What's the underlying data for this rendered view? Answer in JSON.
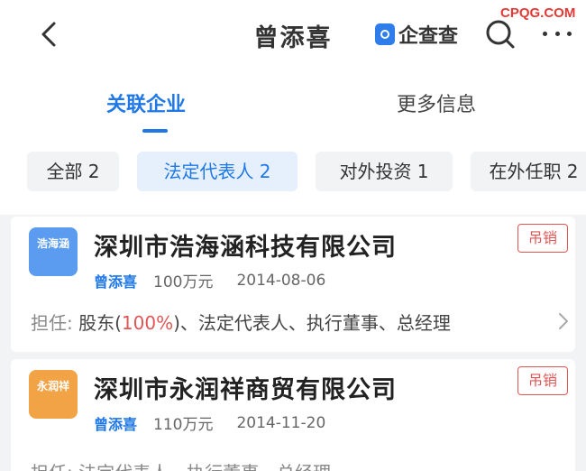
{
  "header": {
    "title": "曾添喜",
    "brand": "企查查",
    "watermark": "CPQG.COM"
  },
  "tabs": [
    {
      "label": "关联企业",
      "active": true
    },
    {
      "label": "更多信息",
      "active": false
    }
  ],
  "filters": [
    {
      "label": "全部 2",
      "active": false
    },
    {
      "label": "法定代表人 2",
      "active": true
    },
    {
      "label": "对外投资 1",
      "active": false
    },
    {
      "label": "在外任职 2",
      "active": false
    }
  ],
  "companies": [
    {
      "name": "深圳市浩海涵科技有限公司",
      "logo_text": "浩海涵",
      "logo_color": "#5b9cf0",
      "status": "吊销",
      "representative": "曾添喜",
      "capital": "100万元",
      "date": "2014-08-06",
      "roles_label": "担任:",
      "roles_before": "股东(",
      "roles_pct": "100%",
      "roles_after": ")、法定代表人、执行董事、总经理"
    },
    {
      "name": "深圳市永润祥商贸有限公司",
      "logo_text": "永润祥",
      "logo_color": "#f2a346",
      "status": "吊销",
      "representative": "曾添喜",
      "capital": "110万元",
      "date": "2014-11-20",
      "roles_label": "担任:",
      "roles_text": "法定代表人、执行董事、总经理"
    }
  ],
  "colors": {
    "accent": "#1f78e6",
    "status": "#e25555"
  }
}
